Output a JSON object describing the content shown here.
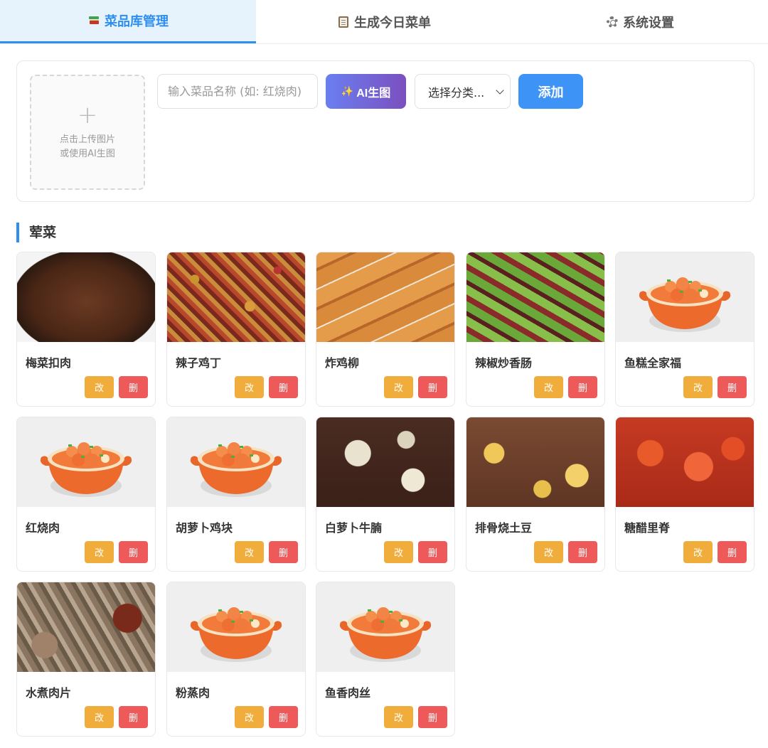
{
  "tabs": [
    {
      "label": "菜品库管理",
      "icon": "books-icon",
      "active": true
    },
    {
      "label": "生成今日菜单",
      "icon": "clipboard-icon",
      "active": false
    },
    {
      "label": "系统设置",
      "icon": "gear-icon",
      "active": false
    }
  ],
  "form": {
    "upload_line1": "点击上传图片",
    "upload_line2": "或使用AI生图",
    "upload_plus": "+",
    "name_placeholder": "输入菜品名称 (如: 红烧肉)",
    "ai_label": "AI生图",
    "category_value": "选择分类...",
    "add_label": "添加"
  },
  "section": {
    "title": "荤菜",
    "edit_label": "改",
    "delete_label": "删",
    "dishes": [
      {
        "name": "梅菜扣肉",
        "image": "meicai"
      },
      {
        "name": "辣子鸡丁",
        "image": "lazi"
      },
      {
        "name": "炸鸡柳",
        "image": "zha"
      },
      {
        "name": "辣椒炒香肠",
        "image": "lajiao"
      },
      {
        "name": "鱼糕全家福",
        "image": "default"
      },
      {
        "name": "红烧肉",
        "image": "default"
      },
      {
        "name": "胡萝卜鸡块",
        "image": "default"
      },
      {
        "name": "白萝卜牛腩",
        "image": "baluobo"
      },
      {
        "name": "排骨烧土豆",
        "image": "paigu"
      },
      {
        "name": "糖醋里脊",
        "image": "tangcu"
      },
      {
        "name": "水煮肉片",
        "image": "shuizhu"
      },
      {
        "name": "粉蒸肉",
        "image": "default"
      },
      {
        "name": "鱼香肉丝",
        "image": "default"
      }
    ]
  },
  "colors": {
    "accent": "#2f8ff0",
    "edit": "#f0ad3c",
    "delete": "#ee5a5a",
    "ai_gradient_start": "#6a7ff0",
    "ai_gradient_end": "#7b4fbf"
  }
}
